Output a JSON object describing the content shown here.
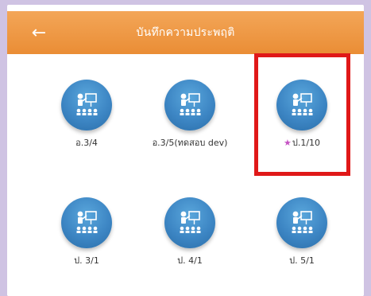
{
  "header": {
    "title": "บันทึกความประพฤติ",
    "back_icon": "arrow-left-icon"
  },
  "classes": [
    {
      "label": "อ.3/4",
      "starred": false,
      "icon": "teacher-classroom-icon"
    },
    {
      "label": "อ.3/5(ทดสอบ dev)",
      "starred": false,
      "icon": "teacher-classroom-icon"
    },
    {
      "label": "ป.1/10",
      "starred": true,
      "icon": "teacher-classroom-icon"
    },
    {
      "label": "ป. 3/1",
      "starred": false,
      "icon": "teacher-classroom-icon"
    },
    {
      "label": "ป. 4/1",
      "starred": false,
      "icon": "teacher-classroom-icon"
    },
    {
      "label": "ป. 5/1",
      "starred": false,
      "icon": "teacher-classroom-icon"
    }
  ],
  "colors": {
    "header": "#ea8d35",
    "icon": "#3d86c4",
    "highlight": "#e01818",
    "star": "#c552c4"
  }
}
